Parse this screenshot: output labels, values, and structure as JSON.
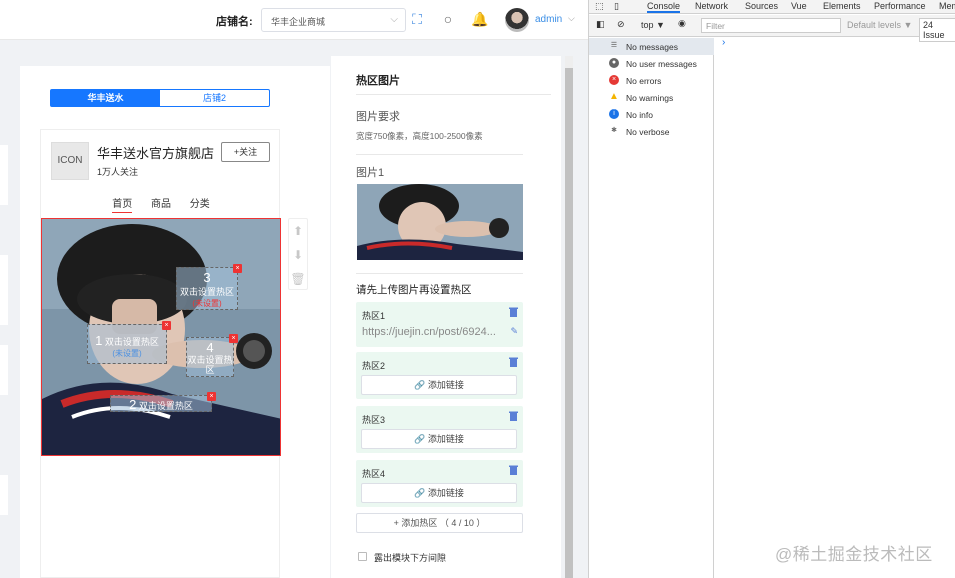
{
  "topbar": {
    "shop_label": "店铺名:",
    "shop_value": "华丰企业商城",
    "user": "admin"
  },
  "preview": {
    "tabs": [
      "华丰送水",
      "店铺2"
    ],
    "active_tab": 0,
    "icon_text": "ICON",
    "shop_name": "华丰送水官方旗舰店",
    "followers": "1万人关注",
    "follow_button": "+关注",
    "nav": [
      "首页",
      "商品",
      "分类"
    ],
    "hotspots": [
      {
        "num": "1",
        "label": "双击设置热区",
        "status": "(未设置)"
      },
      {
        "num": "2",
        "label": "双击设置热区",
        "status": ""
      },
      {
        "num": "3",
        "label": "双击设置热区",
        "status": "(未设置)"
      },
      {
        "num": "4",
        "label": "双击设置热区",
        "status": ""
      }
    ]
  },
  "panel": {
    "title": "热区图片",
    "requirements_title": "图片要求",
    "requirements_text": "宽度750像素，高度100-2500像素",
    "image_label": "图片1",
    "upload_hint": "请先上传图片再设置热区",
    "zones": [
      {
        "label": "热区1",
        "value": "https://juejin.cn/post/6924..."
      },
      {
        "label": "热区2",
        "button": "添加链接"
      },
      {
        "label": "热区3",
        "button": "添加链接"
      },
      {
        "label": "热区4",
        "button": "添加链接"
      }
    ],
    "add_zone": "+ 添加热区 （ 4 / 10 ）",
    "gap_checkbox": "露出模块下方间隙"
  },
  "devtools": {
    "tabs": [
      "Console",
      "Network",
      "Sources",
      "Vue",
      "Elements",
      "Performance",
      "Mem"
    ],
    "context": "top ▼",
    "filter_placeholder": "Filter",
    "levels": "Default levels ▼",
    "issues": "24 Issue",
    "messages": [
      {
        "text": "No messages",
        "icon": "list-icon",
        "color": "#666"
      },
      {
        "text": "No user messages",
        "icon": "user-icon",
        "color": "#666"
      },
      {
        "text": "No errors",
        "icon": "error-icon",
        "color": "#e53935"
      },
      {
        "text": "No warnings",
        "icon": "warning-icon",
        "color": "#f4b400"
      },
      {
        "text": "No info",
        "icon": "info-icon",
        "color": "#1a73e8"
      },
      {
        "text": "No verbose",
        "icon": "bug-icon",
        "color": "#666"
      }
    ],
    "prompt": "›"
  },
  "watermark": "@稀土掘金技术社区"
}
